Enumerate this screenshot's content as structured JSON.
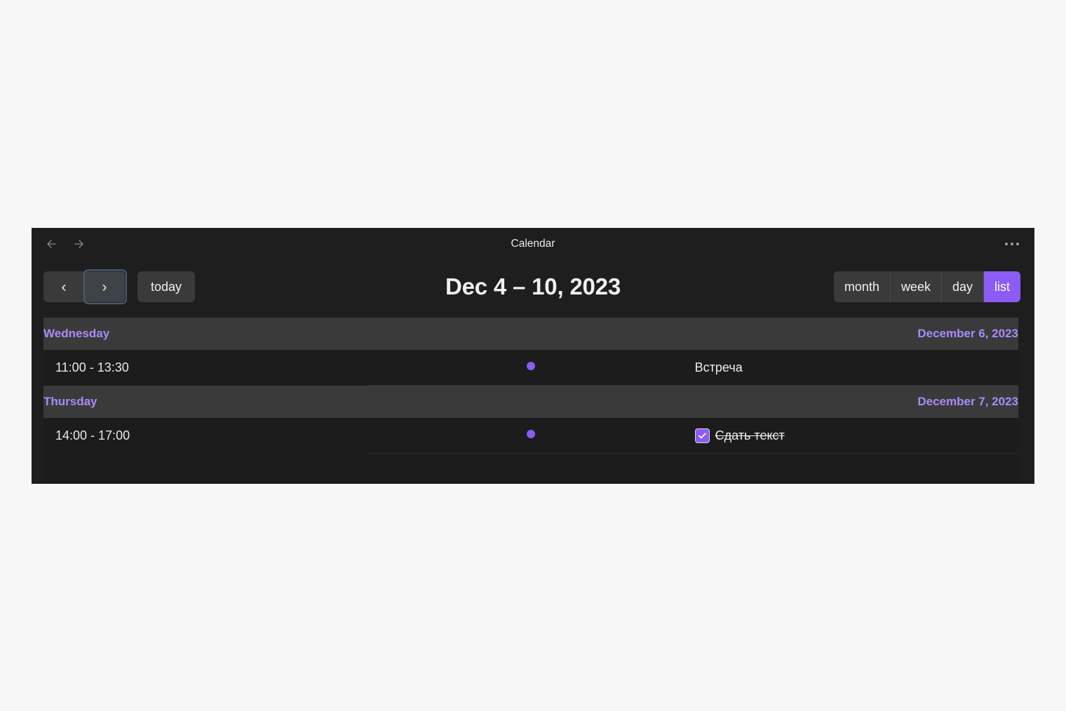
{
  "window": {
    "title": "Calendar",
    "back_icon": "arrow-left-icon",
    "forward_icon": "arrow-right-icon",
    "overflow_icon": "more-horizontal-icon"
  },
  "toolbar": {
    "prev_label": "‹",
    "next_label": "›",
    "today_label": "today",
    "title": "Dec 4 – 10, 2023",
    "views": [
      {
        "label": "month",
        "active": false
      },
      {
        "label": "week",
        "active": false
      },
      {
        "label": "day",
        "active": false
      },
      {
        "label": "list",
        "active": true
      }
    ]
  },
  "theme": {
    "accent": "#8b5cf6",
    "day_header_text": "#a78bfa",
    "page_bg": "#1e1e1e",
    "day_header_bg": "#3a3a3a",
    "event_row_bg": "#1c1c1c"
  },
  "list": {
    "days": [
      {
        "day_name": "Wednesday",
        "day_date": "December 6, 2023",
        "events": [
          {
            "time": "11:00 - 13:30",
            "title": "Встреча",
            "dot_color": "#8b5cf6",
            "has_checkbox": false,
            "checked": false,
            "completed": false
          }
        ]
      },
      {
        "day_name": "Thursday",
        "day_date": "December 7, 2023",
        "events": [
          {
            "time": "14:00 - 17:00",
            "title": "Сдать текст",
            "dot_color": "#8b5cf6",
            "has_checkbox": true,
            "checked": true,
            "completed": true
          }
        ]
      }
    ]
  }
}
